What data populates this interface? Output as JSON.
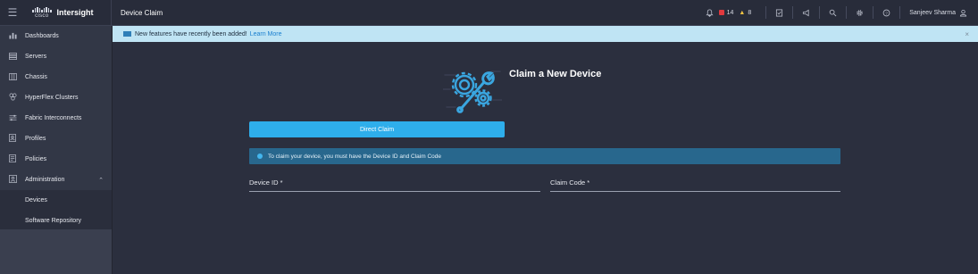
{
  "header": {
    "brand_word": "cisco",
    "brand_name": "Intersight",
    "page_title": "Device Claim",
    "alarms_critical": "14",
    "alarms_warning": "8",
    "user_name": "Sanjeev Sharma"
  },
  "sidebar": {
    "items": [
      {
        "label": "Dashboards",
        "icon": "dashboard-icon"
      },
      {
        "label": "Servers",
        "icon": "server-icon"
      },
      {
        "label": "Chassis",
        "icon": "chassis-icon"
      },
      {
        "label": "HyperFlex Clusters",
        "icon": "hyperflex-icon"
      },
      {
        "label": "Fabric Interconnects",
        "icon": "fabric-icon"
      },
      {
        "label": "Profiles",
        "icon": "profile-icon"
      },
      {
        "label": "Policies",
        "icon": "policy-icon"
      },
      {
        "label": "Administration",
        "icon": "admin-icon"
      }
    ],
    "sub_items": [
      {
        "label": "Devices"
      },
      {
        "label": "Software Repository"
      }
    ]
  },
  "banner": {
    "text": "New features have recently been added!",
    "link": "Learn More",
    "close": "×"
  },
  "main": {
    "title": "Claim a New Device",
    "direct_claim_label": "Direct Claim",
    "info_text": "To claim your device, you must have the Device ID and Claim Code",
    "device_id_label": "Device ID *",
    "claim_code_label": "Claim Code *"
  },
  "colors": {
    "accent": "#2eaeeb",
    "banner_bg": "#bfe4f4",
    "info_bg": "#28678d",
    "critical": "#e0393e",
    "warning": "#f4c542"
  }
}
